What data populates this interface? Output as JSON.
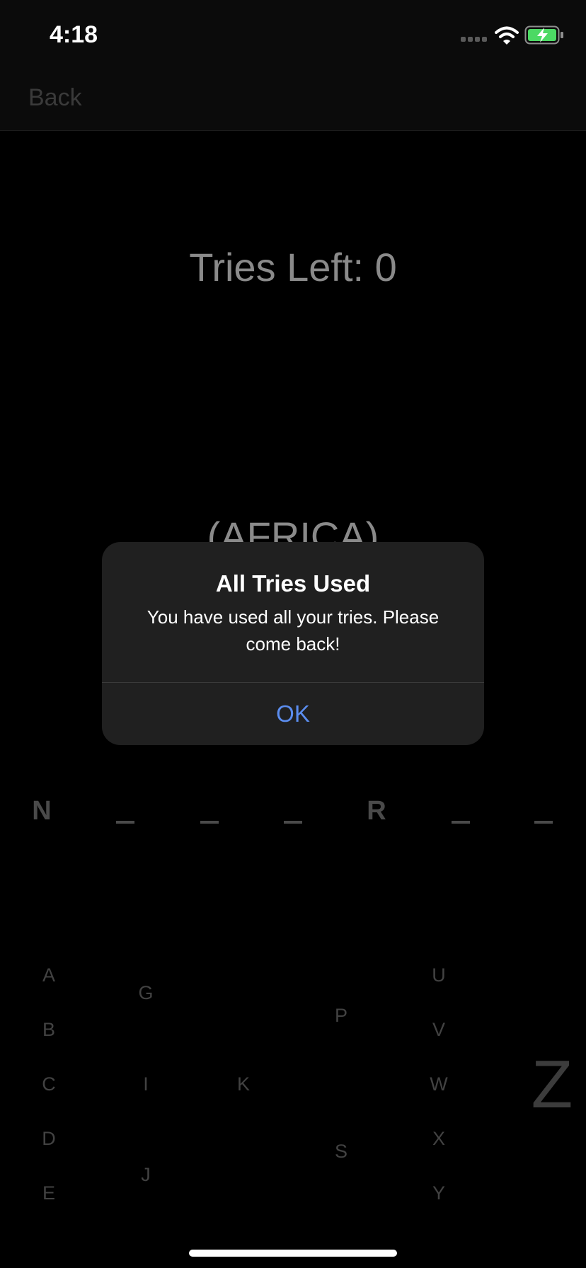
{
  "status_bar": {
    "time": "4:18",
    "battery_color": "#4cd964"
  },
  "nav": {
    "back_label": "Back"
  },
  "game": {
    "tries_left": "Tries Left: 0",
    "category": "(AFRICA)",
    "word_slots": [
      "N",
      "_",
      "_",
      "_",
      "R",
      "_",
      "_"
    ]
  },
  "keyboard": {
    "keys": [
      "A",
      "B",
      "C",
      "D",
      "E",
      "G",
      "I",
      "J",
      "K",
      "P",
      "S",
      "U",
      "V",
      "W",
      "X",
      "Y",
      "Z"
    ]
  },
  "alert": {
    "title": "All Tries Used",
    "message": "You have used all your tries. Please come back!",
    "ok_label": "OK",
    "ok_color": "#5b8def"
  }
}
